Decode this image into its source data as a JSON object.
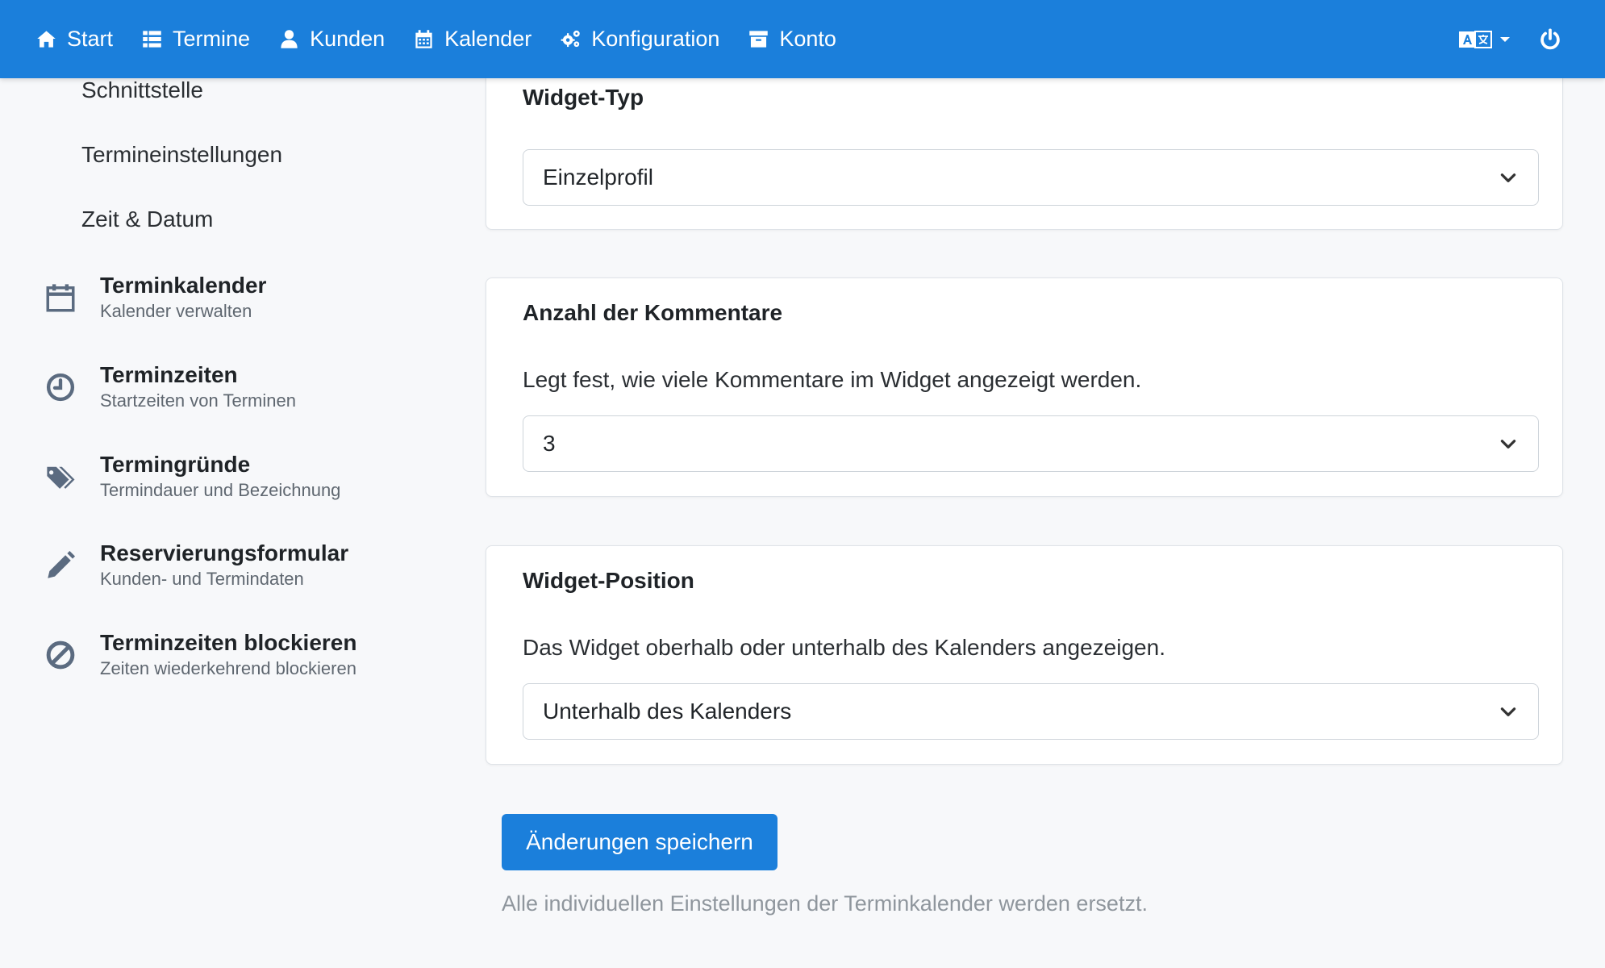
{
  "nav": {
    "items": [
      {
        "label": "Start",
        "icon": "home-icon"
      },
      {
        "label": "Termine",
        "icon": "list-icon"
      },
      {
        "label": "Kunden",
        "icon": "user-icon"
      },
      {
        "label": "Kalender",
        "icon": "calendar-icon"
      },
      {
        "label": "Konfiguration",
        "icon": "gears-icon"
      },
      {
        "label": "Konto",
        "icon": "archive-icon"
      }
    ],
    "language_icon": "translate-icon",
    "logout_icon": "power-icon"
  },
  "sidebar": {
    "sub_items": [
      "Schnittstelle",
      "Termineinstellungen",
      "Zeit & Datum"
    ],
    "items": [
      {
        "title": "Terminkalender",
        "subtitle": "Kalender verwalten",
        "icon": "calendar-icon"
      },
      {
        "title": "Terminzeiten",
        "subtitle": "Startzeiten von Terminen",
        "icon": "clock-icon"
      },
      {
        "title": "Termingründe",
        "subtitle": "Termindauer und Bezeichnung",
        "icon": "tags-icon"
      },
      {
        "title": "Reservierungsformular",
        "subtitle": "Kunden- und Termindaten",
        "icon": "pencil-icon"
      },
      {
        "title": "Terminzeiten blockieren",
        "subtitle": "Zeiten wiederkehrend blockieren",
        "icon": "ban-icon"
      }
    ]
  },
  "main": {
    "widget_type": {
      "title": "Widget-Typ",
      "value": "Einzelprofil"
    },
    "comment_count": {
      "title": "Anzahl der Kommentare",
      "description": "Legt fest, wie viele Kommentare im Widget angezeigt werden.",
      "value": "3"
    },
    "widget_position": {
      "title": "Widget-Position",
      "description": "Das Widget oberhalb oder unterhalb des Kalenders angezeigen.",
      "value": "Unterhalb des Kalenders"
    },
    "save_label": "Änderungen speichern",
    "hint": "Alle individuellen Einstellungen der Terminkalender werden ersetzt."
  },
  "colors": {
    "primary": "#1b7fdb",
    "background": "#f7f8fa",
    "icon": "#5b6b80"
  }
}
